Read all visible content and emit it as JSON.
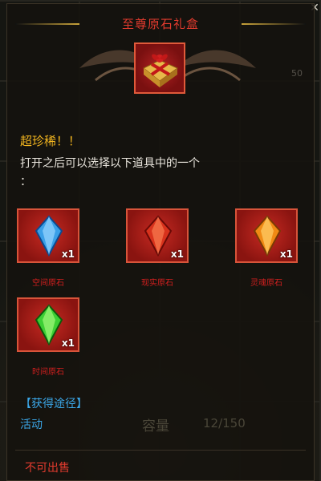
{
  "title": "至尊原石礼盒",
  "rarity_text": "超珍稀！！",
  "description": "打开之后可以选择以下道具中的一个\n：",
  "background_count": "50",
  "items": [
    {
      "name": "空间原石",
      "qty": "x1",
      "icon": "blue-gem-icon",
      "color": "#3aa0e8"
    },
    {
      "name": "现实原石",
      "qty": "x1",
      "icon": "red-gem-icon",
      "color": "#d8321c"
    },
    {
      "name": "灵魂原石",
      "qty": "x1",
      "icon": "orange-gem-icon",
      "color": "#f08a14"
    },
    {
      "name": "时间原石",
      "qty": "x1",
      "icon": "green-gem-icon",
      "color": "#3ccf34"
    }
  ],
  "source": {
    "title": "【获得途径】",
    "value": "活动"
  },
  "capacity": {
    "label": "容量",
    "value": "12/150"
  },
  "sell_status": "不可出售",
  "colors": {
    "title": "#e33b2e",
    "rarity": "#f2b51f",
    "source": "#3ba7e8",
    "gem_label": "#d11f1f"
  }
}
